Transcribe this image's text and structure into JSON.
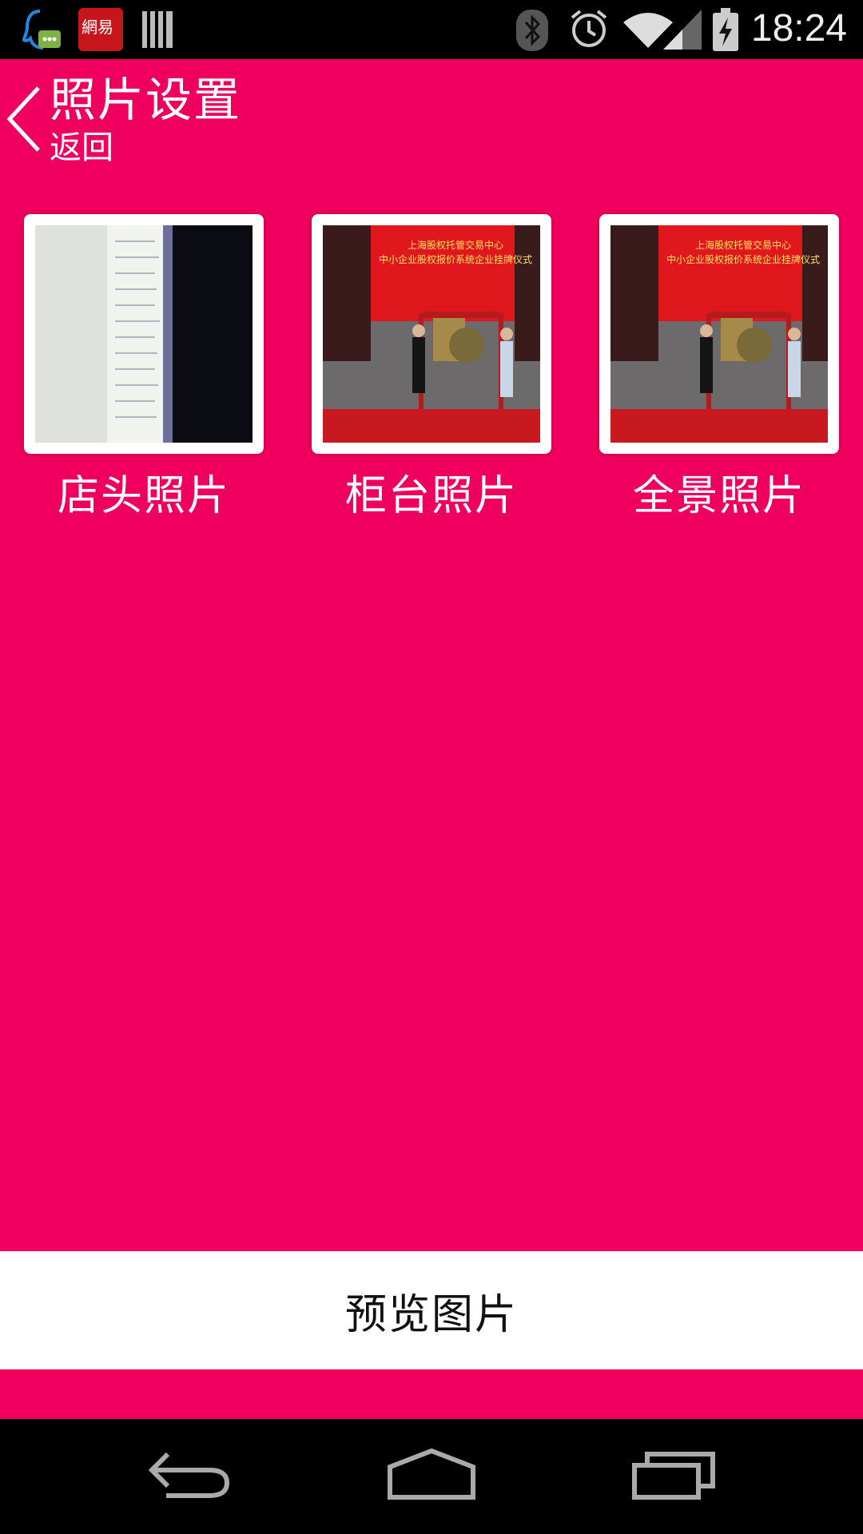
{
  "status_bar": {
    "time": "18:24",
    "icons": [
      "qq-message-icon",
      "netease-news-icon",
      "barcode-icon",
      "bluetooth-icon",
      "alarm-icon",
      "wifi-icon",
      "signal-icon",
      "battery-charging-icon"
    ],
    "netease_badge_text": "網易"
  },
  "header": {
    "title": "照片设置",
    "back_label": "返回"
  },
  "photos": [
    {
      "caption": "店头照片"
    },
    {
      "caption": "柜台照片"
    },
    {
      "caption": "全景照片"
    }
  ],
  "photo_sign": {
    "line1": "上海股权托管交易中心",
    "line2": "中小企业股权报价系统企业挂牌仪式"
  },
  "preview_button": {
    "label": "预览图片"
  },
  "colors": {
    "accent": "#F0005E",
    "status_bar": "#000000",
    "nav_bar": "#000000",
    "button_bg": "#FFFFFF"
  }
}
